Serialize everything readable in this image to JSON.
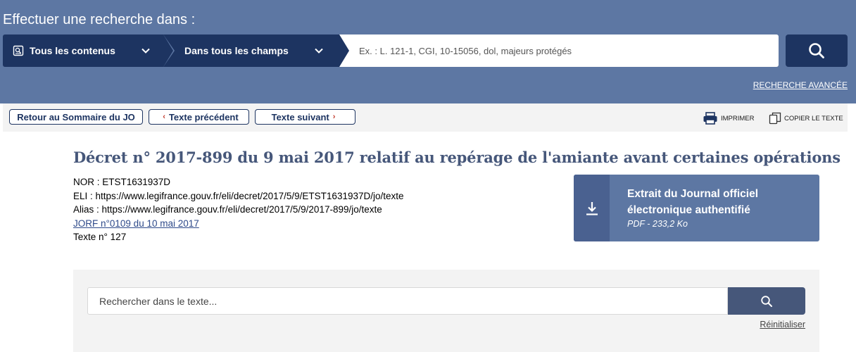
{
  "header": {
    "title": "Effectuer une recherche dans :",
    "scope_dropdown": "Tous les contenus",
    "field_dropdown": "Dans tous les champs",
    "search_placeholder": "Ex. : L. 121-1, CGI, 10-15056, dol, majeurs protégés",
    "advanced_link": "RECHERCHE AVANCÉE"
  },
  "toolbar": {
    "back_label": "Retour au Sommaire du JO",
    "prev_arrow": "‹",
    "prev_label": "Texte précédent",
    "next_label": "Texte suivant",
    "next_arrow": "›",
    "print_label": "IMPRIMER",
    "copy_label": "COPIER LE TEXTE"
  },
  "document": {
    "title": "Décret n° 2017-899 du 9 mai 2017 relatif au repérage de l'amiante avant certaines opérations",
    "nor": "NOR : ETST1631937D",
    "eli": "ELI : https://www.legifrance.gouv.fr/eli/decret/2017/5/9/ETST1631937D/jo/texte",
    "alias": "Alias : https://www.legifrance.gouv.fr/eli/decret/2017/5/9/2017-899/jo/texte",
    "jorf_link": "JORF n°0109 du 10 mai 2017",
    "texte_num": "Texte n° 127"
  },
  "pdf": {
    "title_line1": "Extrait du Journal officiel",
    "title_line2": "électronique authentifié",
    "subtitle": "PDF - 233,2 Ko"
  },
  "inner_search": {
    "placeholder": "Rechercher dans le texte...",
    "reset_label": "Réinitialiser"
  },
  "icons": {
    "scope": "document-search-icon",
    "dropdown": "chevron-down-icon",
    "search": "search-icon",
    "print": "printer-icon",
    "copy": "copy-icon",
    "download": "download-icon"
  },
  "colors": {
    "header_bg": "#5d77a3",
    "dark_navy": "#1d3461",
    "title_color": "#46577a",
    "toolbar_bg": "#f3f3f3",
    "accent_red": "#c0392b"
  }
}
